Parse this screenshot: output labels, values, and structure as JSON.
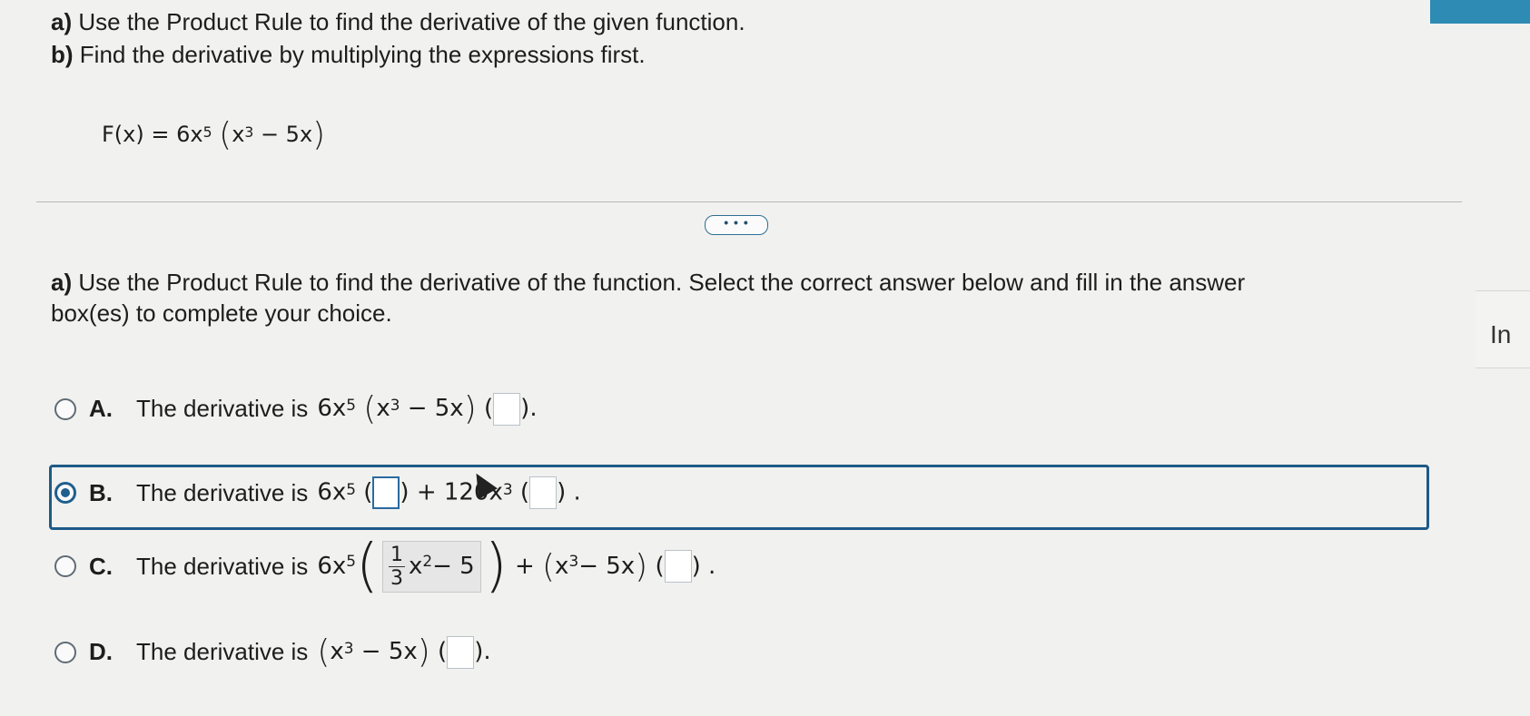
{
  "question": {
    "part_a": {
      "letter": "a)",
      "text": "Use the Product Rule to find the derivative of the given function."
    },
    "part_b": {
      "letter": "b)",
      "text": "Find the derivative by multiplying the expressions first."
    },
    "function": {
      "lhs": "F(x) = 6x",
      "exp1": "5",
      "inner": "x",
      "exp2": "3",
      "tail": " − 5x"
    }
  },
  "expand_button": "• • •",
  "instruction": {
    "letter": "a)",
    "text": "Use the Product Rule to find the derivative of the function. Select the correct answer below and fill in the answer box(es) to complete your choice."
  },
  "side_panel_text": "In",
  "options": {
    "a": {
      "letter": "A.",
      "text": "The derivative is",
      "expr_base": "6x",
      "expr_exp": "5",
      "paren_inner": "x",
      "paren_exp": "3",
      "paren_tail": " − 5x",
      "selected": false
    },
    "b": {
      "letter": "B.",
      "text": "The derivative is",
      "expr_base": "6x",
      "expr_exp": "5",
      "plus_term": "+ 120x",
      "plus_exp": "3",
      "selected": true
    },
    "c": {
      "letter": "C.",
      "text": "The derivative is",
      "expr_base": "6x",
      "expr_exp": "5",
      "frac_num": "1",
      "frac_den": "3",
      "frac_var": "x",
      "frac_exp": "2",
      "frac_tail": " − 5",
      "plus": "+",
      "paren_inner": "x",
      "paren_exp": "3",
      "paren_tail": " − 5x",
      "selected": false
    },
    "d": {
      "letter": "D.",
      "text": "The derivative is",
      "paren_inner": "x",
      "paren_exp": "3",
      "paren_tail": " − 5x",
      "selected": false
    }
  },
  "colors": {
    "accent": "#1f5f8e",
    "topbar": "#2e8bb3"
  }
}
